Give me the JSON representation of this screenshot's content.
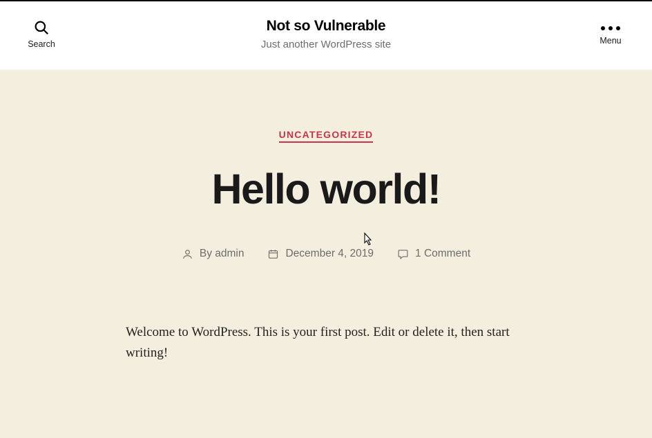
{
  "header": {
    "search_label": "Search",
    "menu_label": "Menu",
    "site_title": "Not so Vulnerable",
    "tagline": "Just another WordPress site"
  },
  "post": {
    "category": "UNCATEGORIZED",
    "title": "Hello world!",
    "author_prefix": "By ",
    "author": "admin",
    "date": "December 4, 2019",
    "comments": "1 Comment",
    "body": "Welcome to WordPress. This is your first post. Edit or delete it, then start writing!"
  }
}
